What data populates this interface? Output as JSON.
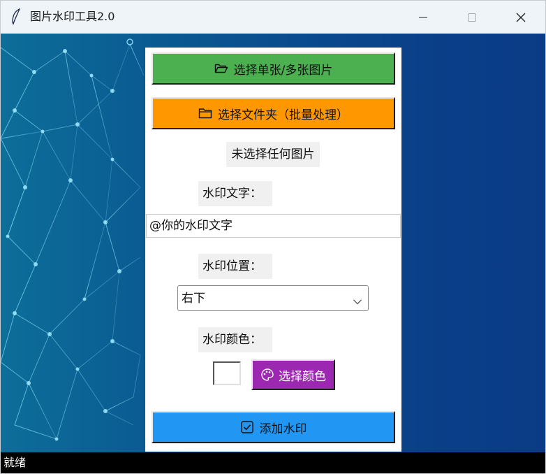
{
  "window": {
    "title": "图片水印工具2.0",
    "icons": {
      "app": "feather-icon",
      "minimize": "minimize-icon",
      "maximize": "maximize-icon",
      "close": "close-icon"
    }
  },
  "panel": {
    "select_images_label": "选择单张/多张图片",
    "select_folder_label": "选择文件夹（批量处理）",
    "file_status": "未选择任何图片",
    "watermark_text_label": "水印文字：",
    "watermark_text_value": "@你的水印文字",
    "watermark_position_label": "水印位置：",
    "watermark_position_value": "右下",
    "watermark_color_label": "水印颜色：",
    "current_color": "#ffffff",
    "choose_color_label": "选择颜色",
    "add_watermark_label": "添加水印"
  },
  "colors": {
    "select_images_bg": "#4caf50",
    "select_folder_bg": "#ff9800",
    "choose_color_bg": "#9c27b0",
    "add_watermark_bg": "#2196f3",
    "statusbar_bg": "#000000"
  },
  "statusbar": {
    "text": "就绪"
  }
}
